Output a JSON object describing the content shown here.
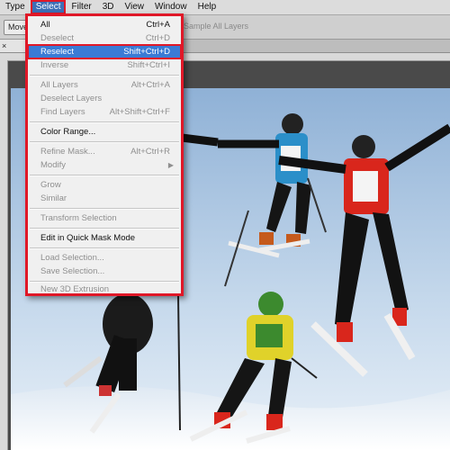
{
  "menubar": {
    "items": [
      "Type",
      "Select",
      "Filter",
      "3D",
      "View",
      "Window",
      "Help"
    ],
    "active_index": 1
  },
  "options_bar": {
    "tool_button": "Move",
    "sample_label": "Sample All Layers"
  },
  "doc_tab": {
    "label": "×"
  },
  "select_menu": {
    "items": [
      {
        "label": "All",
        "shortcut": "Ctrl+A",
        "enabled": true
      },
      {
        "label": "Deselect",
        "shortcut": "Ctrl+D",
        "enabled": false
      },
      {
        "label": "Reselect",
        "shortcut": "Shift+Ctrl+D",
        "enabled": true,
        "highlighted": true
      },
      {
        "label": "Inverse",
        "shortcut": "Shift+Ctrl+I",
        "enabled": false
      },
      {
        "label": "All Layers",
        "shortcut": "Alt+Ctrl+A",
        "enabled": false
      },
      {
        "label": "Deselect Layers",
        "shortcut": "",
        "enabled": false
      },
      {
        "label": "Find Layers",
        "shortcut": "Alt+Shift+Ctrl+F",
        "enabled": false
      },
      {
        "label": "Color Range...",
        "shortcut": "",
        "enabled": true
      },
      {
        "label": "Refine Mask...",
        "shortcut": "Alt+Ctrl+R",
        "enabled": false
      },
      {
        "label": "Modify",
        "shortcut": "",
        "enabled": false,
        "submenu": true
      },
      {
        "label": "Grow",
        "shortcut": "",
        "enabled": false
      },
      {
        "label": "Similar",
        "shortcut": "",
        "enabled": false
      },
      {
        "label": "Transform Selection",
        "shortcut": "",
        "enabled": false
      },
      {
        "label": "Edit in Quick Mask Mode",
        "shortcut": "",
        "enabled": true
      },
      {
        "label": "Load Selection...",
        "shortcut": "",
        "enabled": false
      },
      {
        "label": "Save Selection...",
        "shortcut": "",
        "enabled": false
      },
      {
        "label": "New 3D Extrusion",
        "shortcut": "",
        "enabled": false
      }
    ]
  },
  "colors": {
    "highlight": "#3a7bd5",
    "annotation_red": "#e01828"
  }
}
